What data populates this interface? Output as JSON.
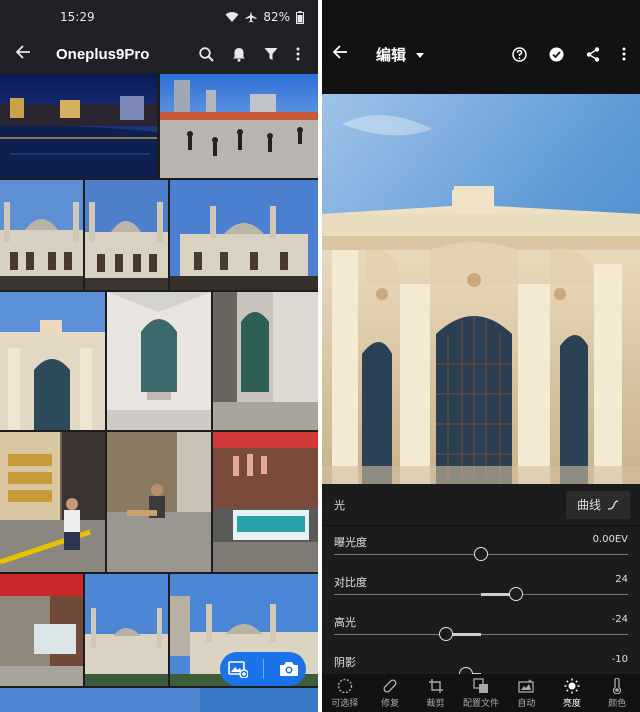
{
  "status": {
    "time": "15:29",
    "battery": "82%"
  },
  "gallery": {
    "title": "Oneplus9Pro"
  },
  "editor": {
    "title": "编辑",
    "panel": {
      "name": "光",
      "curve_label": "曲线"
    },
    "sliders": [
      {
        "label": "曝光度",
        "value": "0.00EV",
        "level": 0.5
      },
      {
        "label": "对比度",
        "value": "24",
        "level": 0.62
      },
      {
        "label": "高光",
        "value": "-24",
        "level": 0.38
      },
      {
        "label": "阴影",
        "value": "-10",
        "level": 0.45
      }
    ],
    "tools": [
      {
        "label": "可选择",
        "icon": "selective-icon"
      },
      {
        "label": "修复",
        "icon": "healing-icon"
      },
      {
        "label": "裁剪",
        "icon": "crop-icon"
      },
      {
        "label": "配置文件",
        "icon": "profiles-icon"
      },
      {
        "label": "自动",
        "icon": "auto-icon"
      },
      {
        "label": "亮度",
        "icon": "light-icon",
        "active": true
      },
      {
        "label": "颜色",
        "icon": "color-icon"
      }
    ]
  },
  "colors": {
    "accent": "#1a73e8",
    "dark_bg": "#1a1a1a",
    "appbar_bg": "#121212"
  }
}
